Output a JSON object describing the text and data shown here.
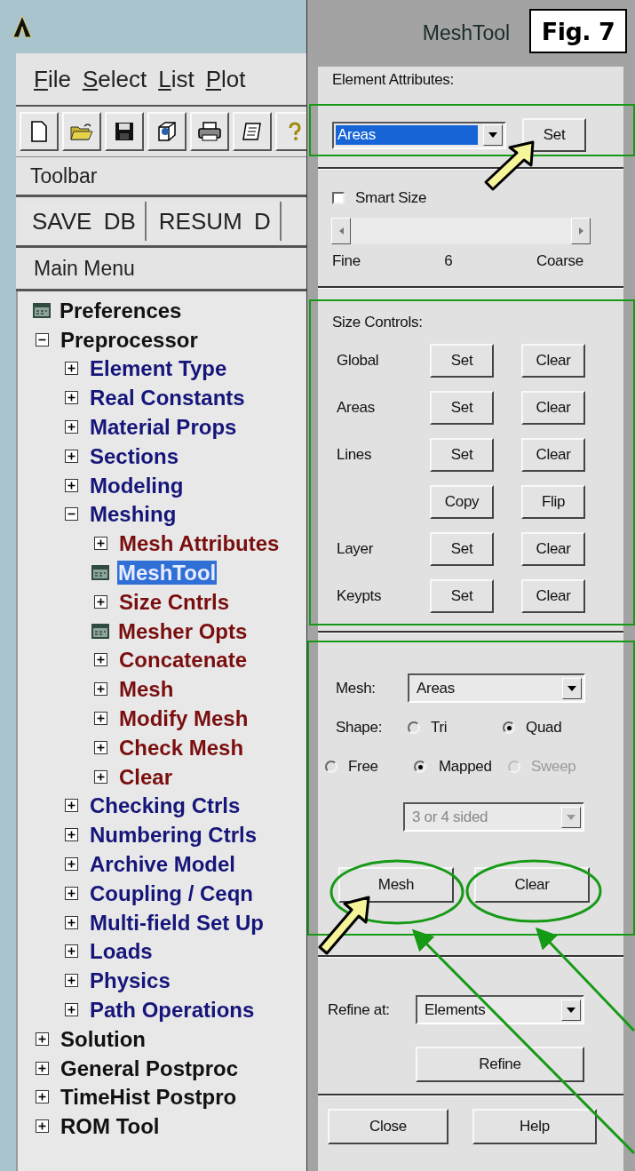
{
  "menu_bar": [
    {
      "label": "File"
    },
    {
      "label": "Select"
    },
    {
      "label": "List"
    },
    {
      "label": "Plot"
    }
  ],
  "toolbar_label": "Toolbar",
  "toolbar_buttons": [
    "SAVE DB",
    "RESUM D"
  ],
  "main_menu_title": "Main Menu",
  "tree": [
    {
      "label": "Preferences",
      "kind": "dialog",
      "selected": false
    },
    {
      "label": "Preprocessor",
      "kind": "folder",
      "expanded": true,
      "selected": false,
      "children": [
        {
          "label": "Element Type",
          "kind": "folder",
          "expanded": false,
          "selected": false
        },
        {
          "label": "Real Constants",
          "kind": "folder",
          "expanded": false,
          "selected": false
        },
        {
          "label": "Material Props",
          "kind": "folder",
          "expanded": false,
          "selected": false
        },
        {
          "label": "Sections",
          "kind": "folder",
          "expanded": false,
          "selected": false
        },
        {
          "label": "Modeling",
          "kind": "folder",
          "expanded": false,
          "selected": false
        },
        {
          "label": "Meshing",
          "kind": "folder",
          "expanded": true,
          "selected": false,
          "children": [
            {
              "label": "Mesh Attributes",
              "kind": "folder",
              "expanded": false,
              "selected": false
            },
            {
              "label": "MeshTool",
              "kind": "dialog",
              "selected": true
            },
            {
              "label": "Size Cntrls",
              "kind": "folder",
              "expanded": false,
              "selected": false
            },
            {
              "label": "Mesher Opts",
              "kind": "dialog",
              "selected": false
            },
            {
              "label": "Concatenate",
              "kind": "folder",
              "expanded": false,
              "selected": false
            },
            {
              "label": "Mesh",
              "kind": "folder",
              "expanded": false,
              "selected": false
            },
            {
              "label": "Modify Mesh",
              "kind": "folder",
              "expanded": false,
              "selected": false
            },
            {
              "label": "Check Mesh",
              "kind": "folder",
              "expanded": false,
              "selected": false
            },
            {
              "label": "Clear",
              "kind": "folder",
              "expanded": false,
              "selected": false
            }
          ]
        },
        {
          "label": "Checking Ctrls",
          "kind": "folder",
          "expanded": false,
          "selected": false
        },
        {
          "label": "Numbering Ctrls",
          "kind": "folder",
          "expanded": false,
          "selected": false
        },
        {
          "label": "Archive Model",
          "kind": "folder",
          "expanded": false,
          "selected": false
        },
        {
          "label": "Coupling / Ceqn",
          "kind": "folder",
          "expanded": false,
          "selected": false
        },
        {
          "label": "Multi-field Set Up",
          "kind": "folder",
          "expanded": false,
          "selected": false
        },
        {
          "label": "Loads",
          "kind": "folder",
          "expanded": false,
          "selected": false
        },
        {
          "label": "Physics",
          "kind": "folder",
          "expanded": false,
          "selected": false
        },
        {
          "label": "Path Operations",
          "kind": "folder",
          "expanded": false,
          "selected": false
        }
      ]
    },
    {
      "label": "Solution",
      "kind": "folder",
      "expanded": false,
      "selected": false
    },
    {
      "label": "General Postproc",
      "kind": "folder",
      "expanded": false,
      "selected": false
    },
    {
      "label": "TimeHist Postpro",
      "kind": "folder",
      "expanded": false,
      "selected": false
    },
    {
      "label": "ROM Tool",
      "kind": "folder",
      "expanded": false,
      "selected": false
    }
  ],
  "dialog": {
    "title": "MeshTool",
    "element_attributes": {
      "label": "Element Attributes:",
      "dropdown": {
        "value": "Areas",
        "highlighted": true
      },
      "button": "Set"
    },
    "smart_size": {
      "label": "Smart Size",
      "checked": false,
      "slider_disabled": true,
      "min_label": "Fine",
      "value": "6",
      "max_label": "Coarse"
    },
    "size_controls": {
      "title": "Size Controls:",
      "rows": [
        {
          "label": "Global",
          "buttons": [
            "Set",
            "Clear"
          ]
        },
        {
          "label": "Areas",
          "buttons": [
            "Set",
            "Clear"
          ]
        },
        {
          "label": "Lines",
          "buttons": [
            "Set",
            "Clear"
          ]
        },
        {
          "buttons": [
            "Copy",
            "Flip"
          ]
        },
        {
          "label": "Layer",
          "buttons": [
            "Set",
            "Clear"
          ]
        },
        {
          "label": "Keypts",
          "buttons": [
            "Set",
            "Clear"
          ]
        }
      ]
    },
    "mesh": {
      "label": "Mesh:",
      "dropdown": {
        "value": "Areas",
        "highlighted": false,
        "disabled": false
      },
      "shape_label": "Shape:",
      "shape_options": [
        {
          "label": "Tri",
          "selected": false
        },
        {
          "label": "Quad",
          "selected": true
        }
      ],
      "mesher_options": [
        {
          "label": "Free",
          "selected": false,
          "disabled": false
        },
        {
          "label": "Mapped",
          "selected": true,
          "disabled": false
        },
        {
          "label": "Sweep",
          "selected": false,
          "disabled": true
        }
      ],
      "sided_dropdown": {
        "value": "3 or 4 sided",
        "highlighted": false,
        "disabled": true
      },
      "buttons": [
        "Mesh",
        "Clear"
      ]
    },
    "refine": {
      "label": "Refine at:",
      "dropdown": {
        "value": "Elements",
        "highlighted": false,
        "disabled": false
      },
      "button": "Refine"
    },
    "buttons": [
      "Close",
      "Help"
    ]
  },
  "figure_label": "Fig. 7"
}
